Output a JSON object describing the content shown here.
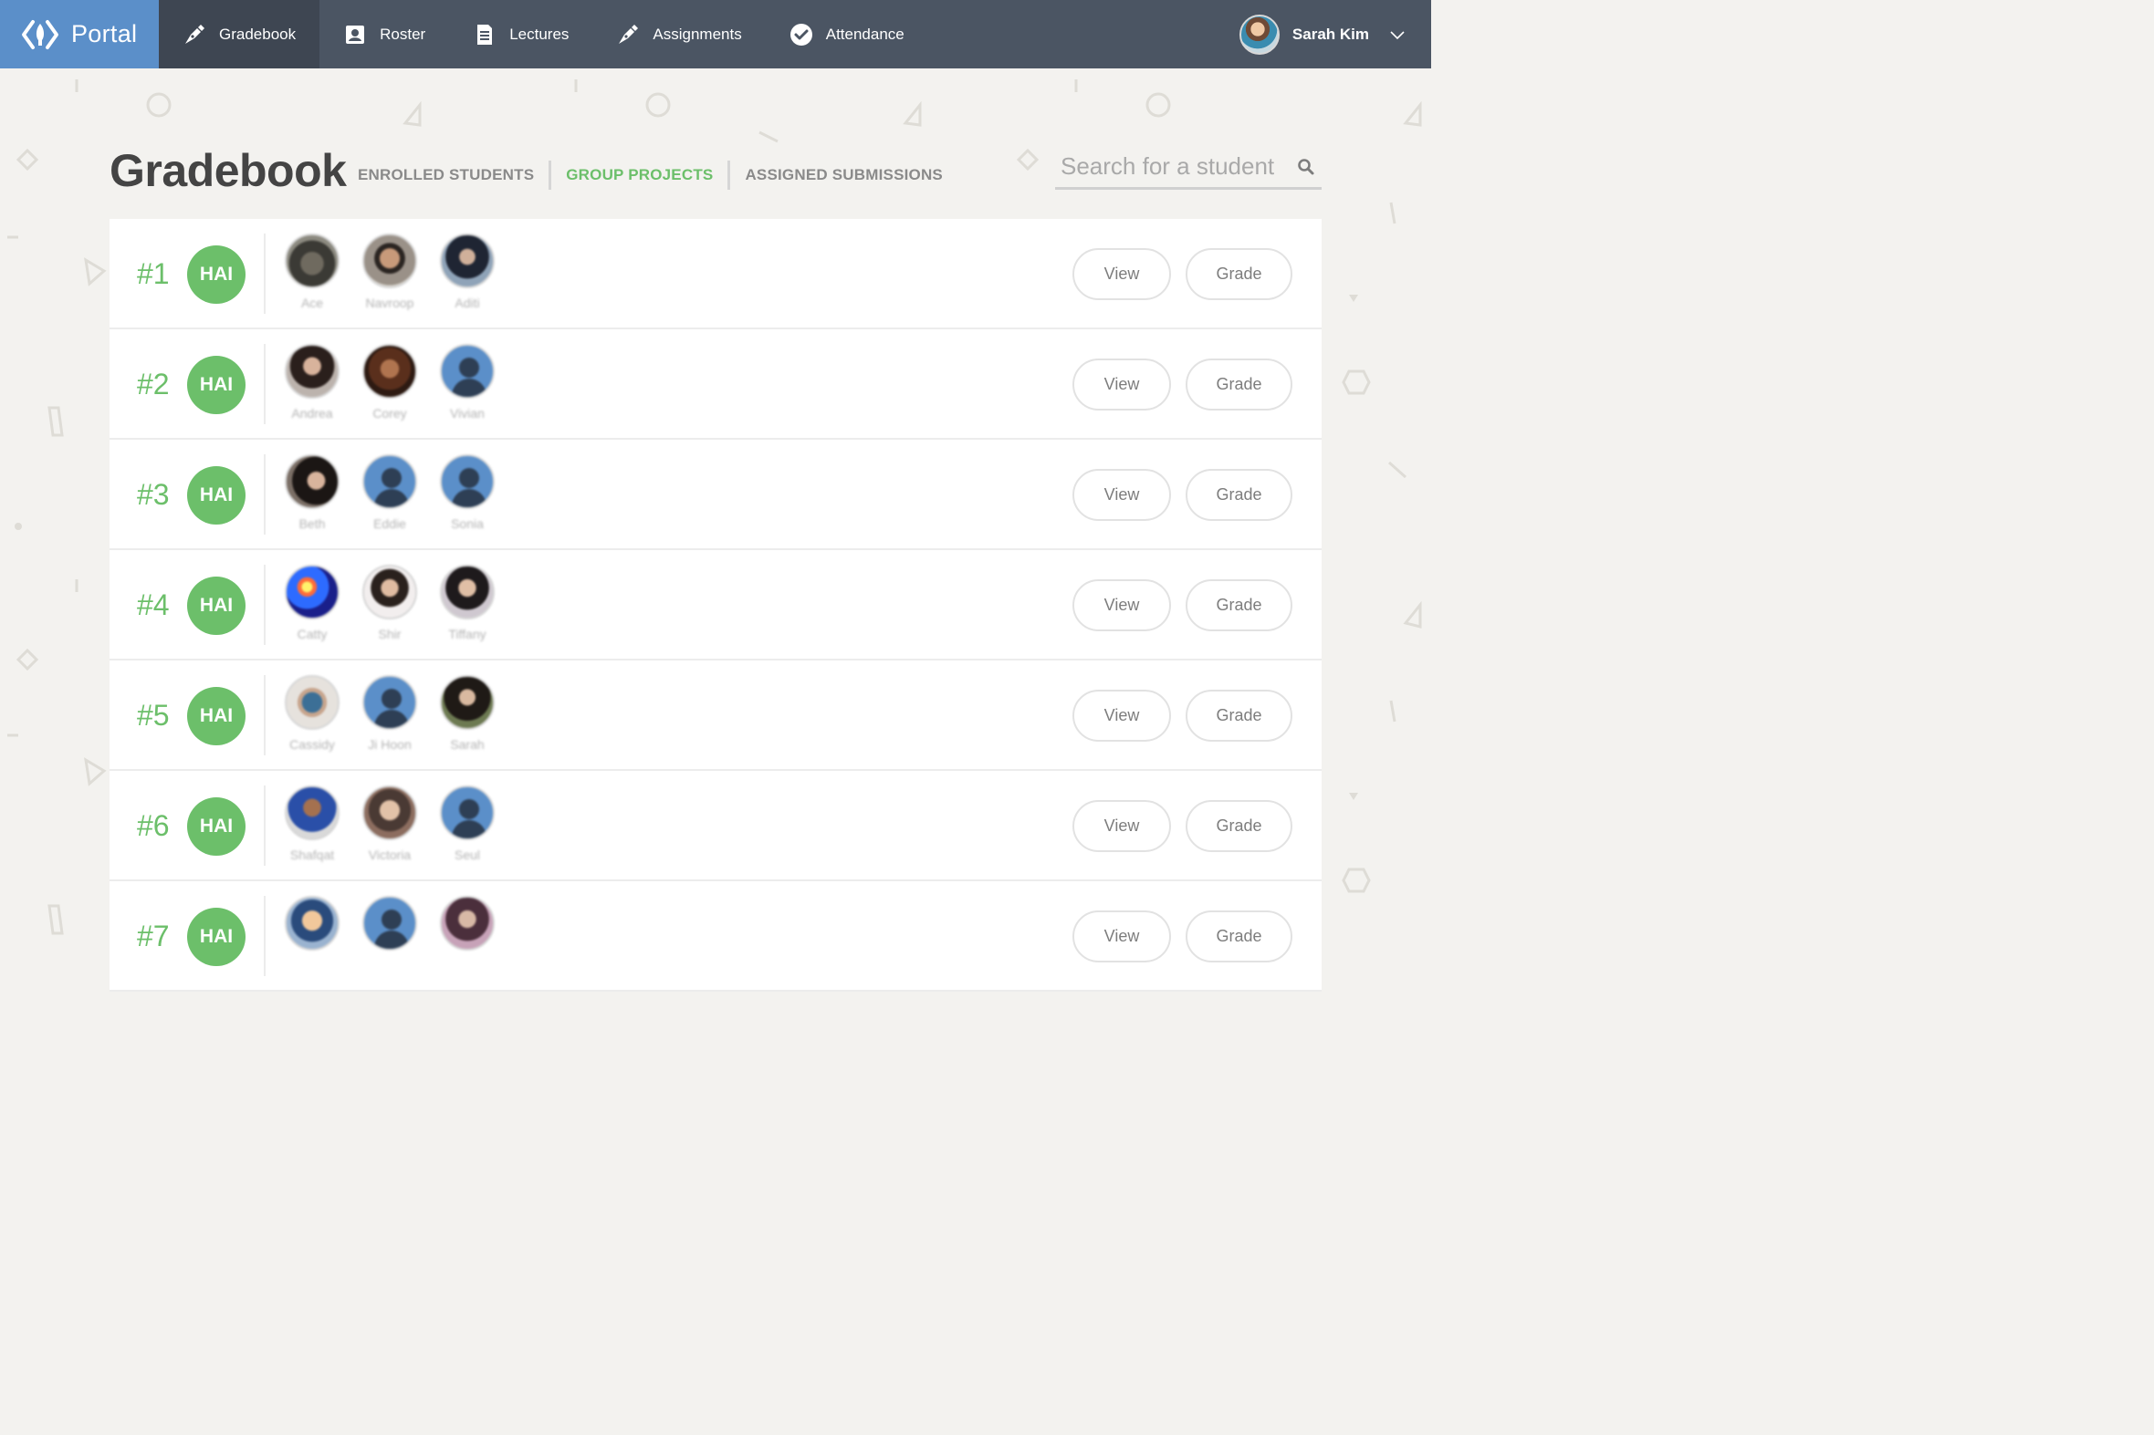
{
  "brand": {
    "name": "Portal",
    "logo_icon": "code-brackets-icon"
  },
  "nav": {
    "items": [
      {
        "label": "Gradebook",
        "icon": "pen-nib-icon",
        "active": true
      },
      {
        "label": "Roster",
        "icon": "contact-card-icon",
        "active": false
      },
      {
        "label": "Lectures",
        "icon": "document-icon",
        "active": false
      },
      {
        "label": "Assignments",
        "icon": "pen-nib-icon",
        "active": false
      },
      {
        "label": "Attendance",
        "icon": "check-circle-icon",
        "active": false
      }
    ],
    "user": {
      "name": "Sarah Kim",
      "menu_icon": "chevron-down-icon"
    }
  },
  "page": {
    "title": "Gradebook",
    "tabs": [
      {
        "label": "ENROLLED STUDENTS",
        "active": false
      },
      {
        "label": "GROUP PROJECTS",
        "active": true
      },
      {
        "label": "ASSIGNED SUBMISSIONS",
        "active": false
      }
    ],
    "search": {
      "placeholder": "Search for a student",
      "icon": "search-icon"
    }
  },
  "colors": {
    "nav_bg": "#4b5563",
    "brand_bg": "#5b8fc9",
    "accent_green": "#6cbf6a",
    "page_bg": "#f3f2ef"
  },
  "groups": [
    {
      "rank": "#1",
      "badge": "HAI",
      "members": [
        {
          "name": "Ace",
          "photo": "photo-a"
        },
        {
          "name": "Navroop",
          "photo": "photo-b"
        },
        {
          "name": "Aditi",
          "photo": "photo-c"
        }
      ]
    },
    {
      "rank": "#2",
      "badge": "HAI",
      "members": [
        {
          "name": "Andrea",
          "photo": "photo-d"
        },
        {
          "name": "Corey",
          "photo": "photo-e"
        },
        {
          "name": "Vivian",
          "photo": "default"
        }
      ]
    },
    {
      "rank": "#3",
      "badge": "HAI",
      "members": [
        {
          "name": "Beth",
          "photo": "photo-f"
        },
        {
          "name": "Eddie",
          "photo": "default"
        },
        {
          "name": "Sonia",
          "photo": "default"
        }
      ]
    },
    {
      "rank": "#4",
      "badge": "HAI",
      "members": [
        {
          "name": "Catty",
          "photo": "photo-g"
        },
        {
          "name": "Shir",
          "photo": "photo-h"
        },
        {
          "name": "Tiffany",
          "photo": "photo-i"
        }
      ]
    },
    {
      "rank": "#5",
      "badge": "HAI",
      "members": [
        {
          "name": "Cassidy",
          "photo": "photo-j"
        },
        {
          "name": "Ji Hoon",
          "photo": "default"
        },
        {
          "name": "Sarah",
          "photo": "photo-k"
        }
      ]
    },
    {
      "rank": "#6",
      "badge": "HAI",
      "members": [
        {
          "name": "Shafqat",
          "photo": "photo-l"
        },
        {
          "name": "Victoria",
          "photo": "photo-m"
        },
        {
          "name": "Seul",
          "photo": "default"
        }
      ]
    },
    {
      "rank": "#7",
      "badge": "HAI",
      "members": [
        {
          "name": "",
          "photo": "photo-n"
        },
        {
          "name": "",
          "photo": "default"
        },
        {
          "name": "",
          "photo": "photo-o"
        }
      ]
    }
  ],
  "row_actions": {
    "view_label": "View",
    "grade_label": "Grade"
  }
}
